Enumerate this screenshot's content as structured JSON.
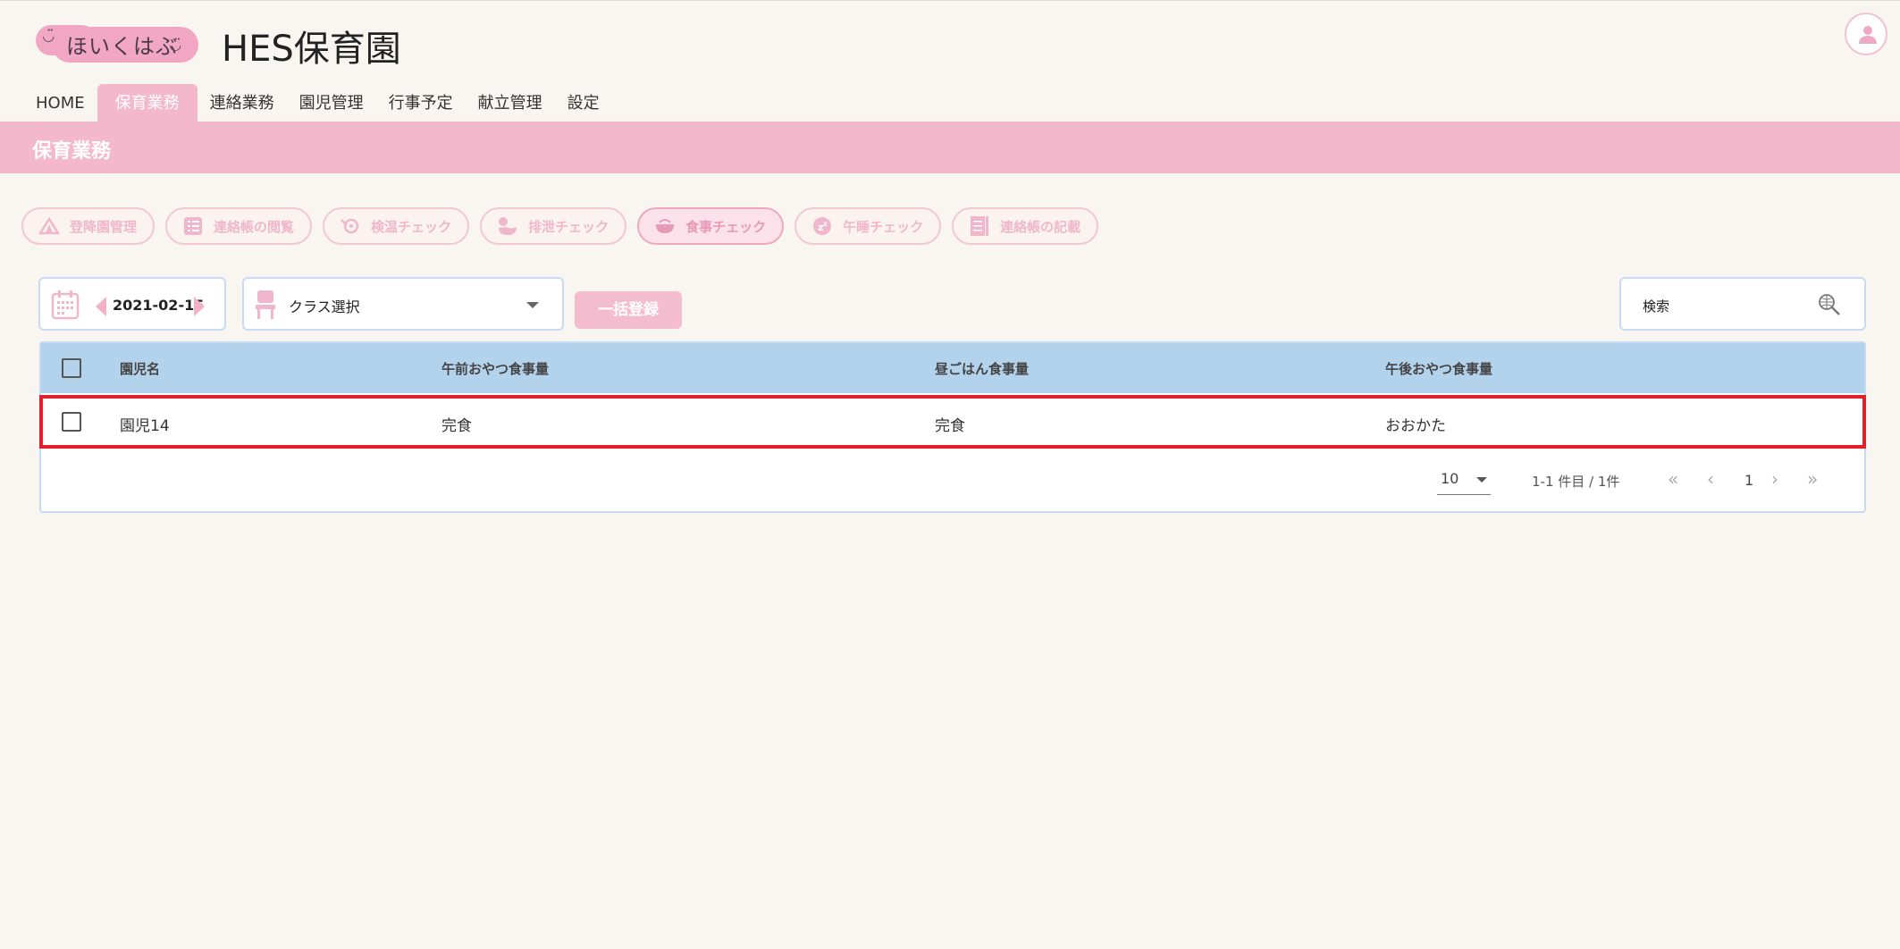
{
  "app": {
    "logo_text": "ほいくはぶ",
    "title": "HES保育園"
  },
  "nav": {
    "tabs": [
      {
        "label": "HOME",
        "active": false
      },
      {
        "label": "保育業務",
        "active": true
      },
      {
        "label": "連絡業務",
        "active": false
      },
      {
        "label": "園児管理",
        "active": false
      },
      {
        "label": "行事予定",
        "active": false
      },
      {
        "label": "献立管理",
        "active": false
      },
      {
        "label": "設定",
        "active": false
      }
    ]
  },
  "section": {
    "title": "保育業務"
  },
  "functions": [
    {
      "label": "登降園管理",
      "icon": "tent-icon",
      "active": false
    },
    {
      "label": "連絡帳の閲覧",
      "icon": "list-icon",
      "active": false
    },
    {
      "label": "検温チェック",
      "icon": "thermometer-icon",
      "active": false
    },
    {
      "label": "排泄チェック",
      "icon": "duck-icon",
      "active": false
    },
    {
      "label": "食事チェック",
      "icon": "bowl-icon",
      "active": true
    },
    {
      "label": "午睡チェック",
      "icon": "sleep-icon",
      "active": false
    },
    {
      "label": "連絡帳の記載",
      "icon": "notebook-icon",
      "active": false
    }
  ],
  "toolbar": {
    "date": "2021-02-15",
    "class_select": "クラス選択",
    "bulk_button": "一括登録",
    "search_placeholder": "検索"
  },
  "table": {
    "columns": [
      "園児名",
      "午前おやつ食事量",
      "昼ごはん食事量",
      "午後おやつ食事量"
    ],
    "rows": [
      {
        "name": "園児14",
        "am_snack": "完食",
        "lunch": "完食",
        "pm_snack": "おおかた"
      }
    ],
    "pagination": {
      "per_page": "10",
      "range": "1-1 件目 / 1件",
      "page": "1"
    }
  },
  "colors": {
    "accent_pink": "#f3b8cb",
    "header_blue": "#b3d3ec",
    "highlight_red": "#e0202a"
  }
}
